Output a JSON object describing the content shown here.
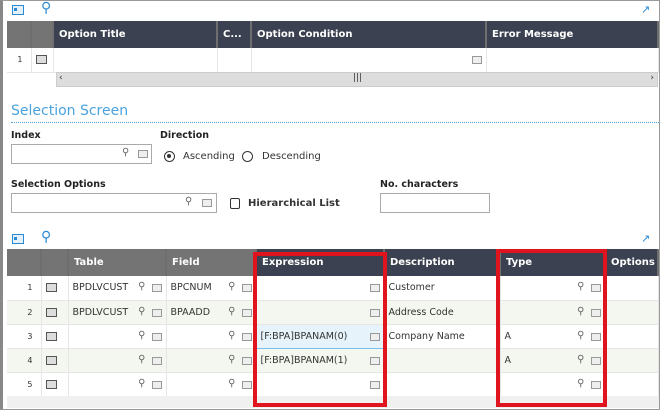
{
  "top_grid": {
    "columns": [
      "Option Title",
      "C...",
      "Option Condition",
      "Error Message"
    ],
    "rows": [
      {
        "num": "1"
      }
    ]
  },
  "section_title": "Selection Screen",
  "index": {
    "label": "Index",
    "value": ""
  },
  "direction": {
    "label": "Direction",
    "options": [
      "Ascending",
      "Descending"
    ],
    "selected": "Ascending"
  },
  "selection_options": {
    "label": "Selection Options",
    "value": ""
  },
  "hierarchical": {
    "label": "Hierarchical List",
    "checked": false
  },
  "no_chars": {
    "label": "No. characters",
    "value": ""
  },
  "bottom_grid": {
    "columns": [
      "Table",
      "Field",
      "Expression",
      "Description",
      "Type",
      "Options"
    ],
    "rows": [
      {
        "num": "1",
        "table": "BPDLVCUST",
        "field": "BPCNUM",
        "expression": "",
        "description": "Customer",
        "type": ""
      },
      {
        "num": "2",
        "table": "BPDLVCUST",
        "field": "BPAADD",
        "expression": "",
        "description": "Address Code",
        "type": ""
      },
      {
        "num": "3",
        "table": "",
        "field": "",
        "expression": "[F:BPA]BPANAM(0)",
        "description": "Company Name",
        "type": "A"
      },
      {
        "num": "4",
        "table": "",
        "field": "",
        "expression": "[F:BPA]BPANAM(1)",
        "description": "",
        "type": "A"
      },
      {
        "num": "5",
        "table": "",
        "field": "",
        "expression": "",
        "description": "",
        "type": ""
      }
    ]
  },
  "colors": {
    "accent": "#2a8ad4",
    "header": "#3b4150",
    "highlight": "#e0141e"
  }
}
